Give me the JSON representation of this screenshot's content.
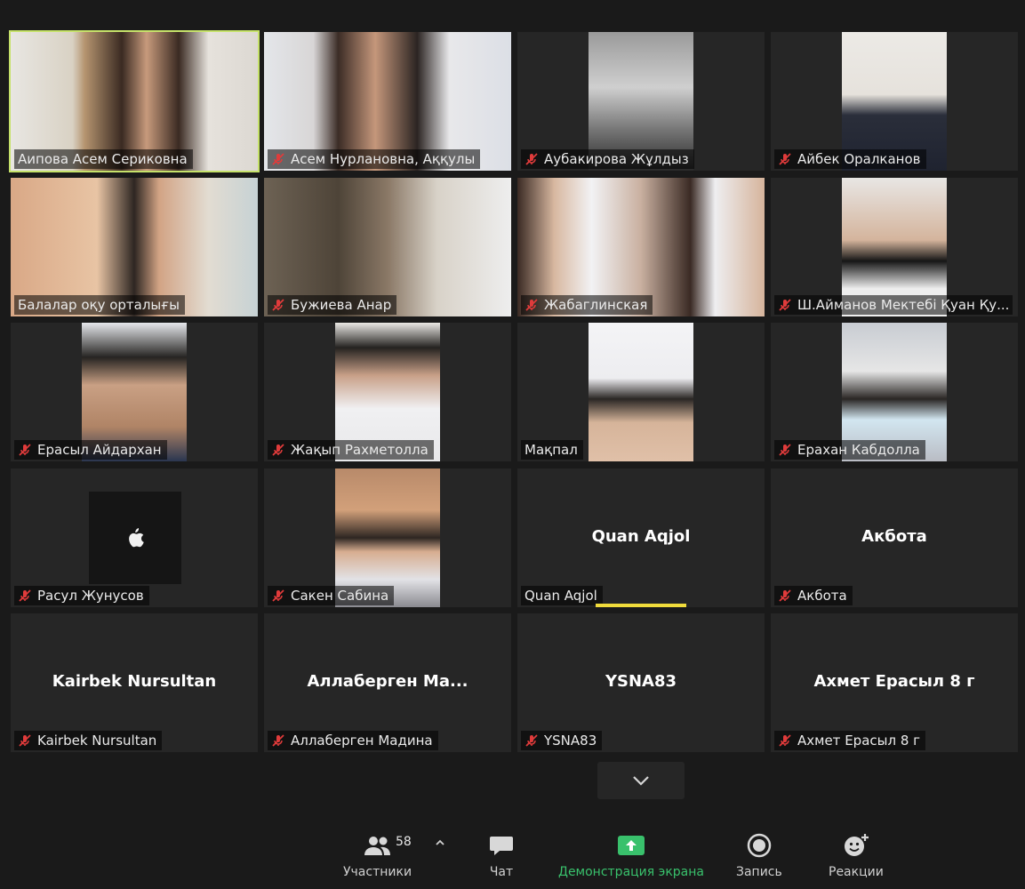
{
  "colors": {
    "background": "#1a1a1a",
    "tile": "#262626",
    "active_speaker_border": "#c6e26a",
    "speaking_indicator": "#f1dc3c",
    "muted_mic": "#e03b3b",
    "share_green": "#39c16c"
  },
  "participants": [
    {
      "name": "Аипова Асем Сериковна",
      "muted": false,
      "active": true
    },
    {
      "name": "Асем Нурлановна,  Аққулы",
      "muted": true
    },
    {
      "name": "Аубакирова Жұлдыз",
      "muted": true
    },
    {
      "name": "Айбек Оралканов",
      "muted": true
    },
    {
      "name": "Балалар оқу орталығы",
      "muted": false
    },
    {
      "name": "Бужиева Анар",
      "muted": true
    },
    {
      "name": "Жабаглинская",
      "muted": true
    },
    {
      "name": "Ш.Айманов Мектебі Қуан Қу...",
      "muted": true
    },
    {
      "name": "Ерасыл Айдархан",
      "muted": true
    },
    {
      "name": "Жақып Рахметолла",
      "muted": true
    },
    {
      "name": "Мақпал",
      "muted": false
    },
    {
      "name": "Ерахан Кабдолла",
      "muted": true
    },
    {
      "name": "Расул Жунусов",
      "muted": true,
      "avatar_icon": "apple-icon"
    },
    {
      "name": "Сакен Сабина",
      "muted": true
    },
    {
      "name": "Quan Aqjol",
      "muted": false,
      "display_name": "Quan Aqjol",
      "speaking": true
    },
    {
      "name": "Акбота",
      "muted": true,
      "display_name": "Акбота"
    },
    {
      "name": "Kairbek Nursultan",
      "muted": true,
      "display_name": "Kairbek Nursultan"
    },
    {
      "name": "Аллаберген Мадина",
      "muted": true,
      "display_name": "Аллаберген  Ма..."
    },
    {
      "name": "YSNA83",
      "muted": true,
      "display_name": "YSNA83"
    },
    {
      "name": "Ахмет Ерасыл 8 г",
      "muted": true,
      "display_name": "Ахмет Ерасыл 8 г"
    }
  ],
  "pager": {
    "icon": "chevron-down-icon"
  },
  "toolbar": {
    "participants_label": "Участники",
    "participants_count": "58",
    "chat_label": "Чат",
    "share_label": "Демонстрация экрана",
    "record_label": "Запись",
    "reactions_label": "Реакции"
  }
}
